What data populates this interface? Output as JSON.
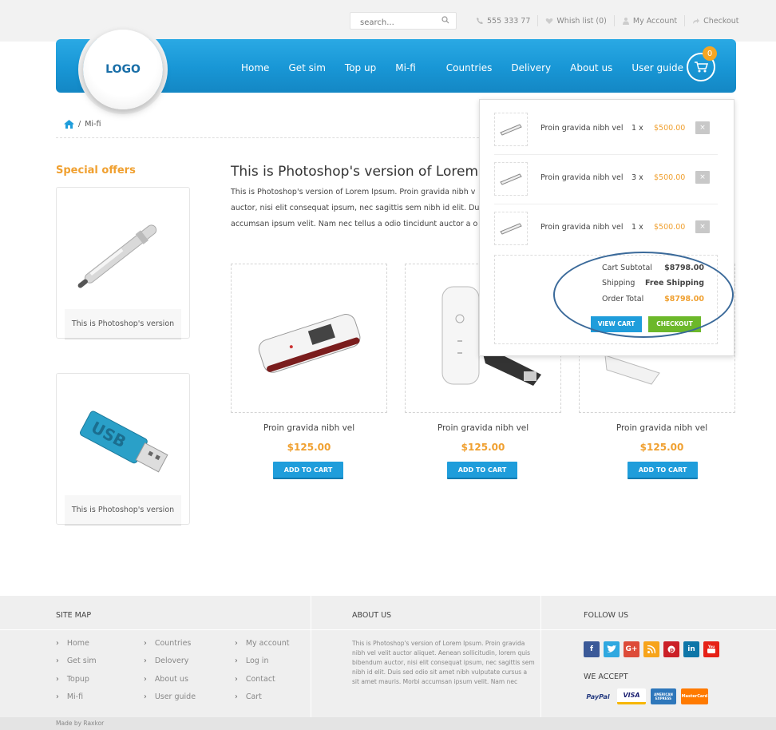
{
  "topbar": {
    "search_placeholder": "search...",
    "phone": "555 333 77",
    "wishlist": "Whish list (0)",
    "account": "My Account",
    "checkout": "Checkout"
  },
  "header": {
    "logo": "LOGO",
    "nav": [
      "Home",
      "Get sim",
      "Top up",
      "Mi-fi",
      "Countries",
      "Delivery",
      "About us",
      "User guide"
    ],
    "cart_count": "0"
  },
  "breadcrumb": {
    "current": "Mi-fi"
  },
  "sidebar": {
    "title": "Special offers",
    "cards": [
      {
        "caption": "This is Photoshop's version",
        "image": "pen-usb-icon"
      },
      {
        "caption": "This is Photoshop's version",
        "image": "usb-drive-icon"
      }
    ]
  },
  "main": {
    "title": "This is Photoshop's version  of Lorem Ipsu",
    "text_lines": [
      "This is Photoshop's version  of Lorem Ipsum. Proin gravida nibh v",
      "auctor, nisi elit consequat ipsum, nec sagittis sem nibh id elit. Dui",
      "accumsan ipsum velit. Nam nec tellus a odio tincidunt auctor a o"
    ],
    "products": [
      {
        "name": "Proin gravida nibh vel",
        "price": "$125.00",
        "button": "ADD TO CART"
      },
      {
        "name": "Proin gravida nibh vel",
        "price": "$125.00",
        "button": "ADD TO CART"
      },
      {
        "name": "Proin gravida nibh vel",
        "price": "$125.00",
        "button": "ADD TO CART"
      }
    ]
  },
  "cart": {
    "items": [
      {
        "name": "Proin gravida nibh vel",
        "qty": "1 x",
        "price": "$500.00",
        "remove": "×"
      },
      {
        "name": "Proin gravida nibh vel",
        "qty": "3 x",
        "price": "$500.00",
        "remove": "×"
      },
      {
        "name": "Proin gravida nibh vel",
        "qty": "1 x",
        "price": "$500.00",
        "remove": "×"
      }
    ],
    "subtotal_label": "Cart Subtotal",
    "subtotal": "$8798.00",
    "shipping_label": "Shipping",
    "shipping": "Free Shipping",
    "total_label": "Order Total",
    "total": "$8798.00",
    "view_cart": "VIEW CART",
    "checkout": "CHECKOUT"
  },
  "footer": {
    "sitemap_title": "SITE MAP",
    "col1": [
      "Home",
      "Get sim",
      "Topup",
      "Mi-fi"
    ],
    "col2": [
      "Countries",
      "Delovery",
      "About us",
      "User guide"
    ],
    "col3": [
      "My account",
      "Log in",
      "Contact",
      "Cart"
    ],
    "about_title": "ABOUT US",
    "about_text": "This is Photoshop's version  of Lorem Ipsum. Proin gravida nibh vel velit auctor aliquet. Aenean sollicitudin, lorem quis bibendum auctor, nisi elit consequat ipsum, nec sagittis sem nibh id elit. Duis sed odio sit amet nibh vulputate cursus a sit amet mauris. Morbi accumsan ipsum velit. Nam nec",
    "follow_title": "FOLLOW US",
    "social": [
      {
        "label": "f",
        "color": "#3b5998",
        "name": "facebook-icon"
      },
      {
        "label": "t",
        "color": "#2fa8e0",
        "name": "twitter-icon"
      },
      {
        "label": "G+",
        "color": "#dd4b39",
        "name": "google-plus-icon"
      },
      {
        "label": "rss",
        "color": "#f7a41b",
        "name": "rss-icon"
      },
      {
        "label": "p",
        "color": "#cb2027",
        "name": "pinterest-icon"
      },
      {
        "label": "in",
        "color": "#0e76a8",
        "name": "linkedin-icon"
      },
      {
        "label": "yt",
        "color": "#e62117",
        "name": "youtube-icon"
      }
    ],
    "accept_title": "WE ACCEPT",
    "payments": [
      "PayPal",
      "VISA",
      "AMERICAN EXPRESS",
      "MasterCard"
    ],
    "made_by": "Made by Raxkor"
  }
}
